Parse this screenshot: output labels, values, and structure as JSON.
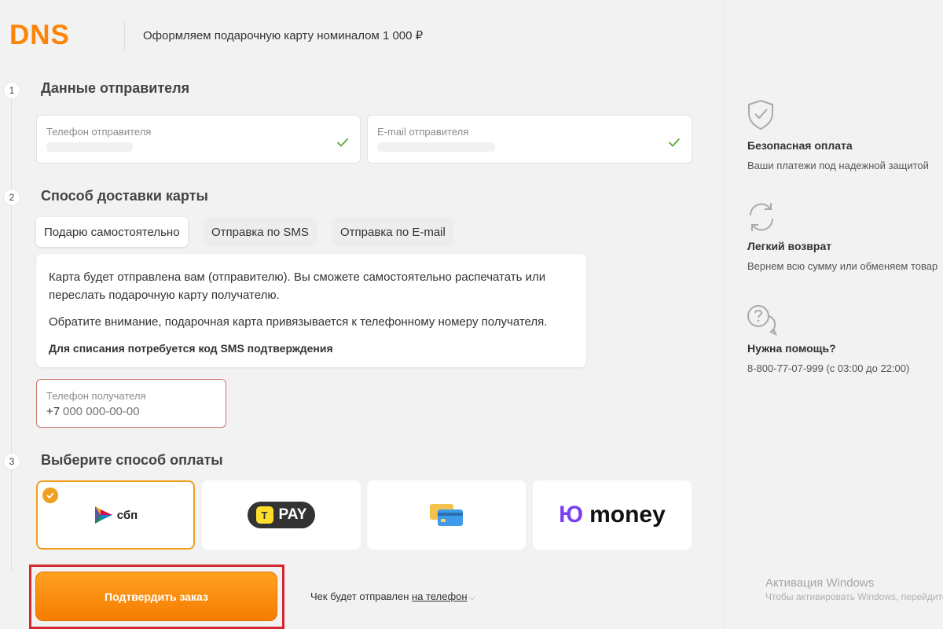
{
  "header": {
    "logo_text": "DNS",
    "title": "Оформляем подарочную карту номиналом 1 000 ₽"
  },
  "steps": [
    {
      "number": "1",
      "title": "Данные отправителя"
    },
    {
      "number": "2",
      "title": "Способ доставки карты"
    },
    {
      "number": "3",
      "title": "Выберите способ оплаты"
    }
  ],
  "sender": {
    "phone_label": "Телефон отправителя",
    "email_label": "E-mail отправителя"
  },
  "delivery_tabs": [
    {
      "label": "Подарю самостоятельно",
      "active": true
    },
    {
      "label": "Отправка по SMS",
      "active": false
    },
    {
      "label": "Отправка по E-mail",
      "active": false
    }
  ],
  "info": {
    "line1": "Карта будет отправлена вам (отправителю). Вы сможете самостоятельно распечатать или переслать подарочную карту получателю.",
    "line2": "Обратите внимание, подарочная карта привязывается к телефонному номеру получателя.",
    "line3": "Для списания потребуется код SMS подтверждения"
  },
  "recipient": {
    "label": "Телефон получателя",
    "prefix": "+7",
    "placeholder": "000 000-00-00"
  },
  "payments": [
    {
      "name": "СБП",
      "text": "сбп",
      "selected": true
    },
    {
      "name": "T-Pay",
      "text": "PAY",
      "badge": "T",
      "selected": false
    },
    {
      "name": "Card",
      "text": "",
      "selected": false
    },
    {
      "name": "ЮMoney",
      "mark": "Ю",
      "text": "money",
      "selected": false
    }
  ],
  "confirm": {
    "label": "Подтвердить заказ",
    "receipt_prefix": "Чек будет отправлен",
    "receipt_link": "на телефон"
  },
  "features": [
    {
      "icon": "shield-check-icon",
      "title": "Безопасная оплата",
      "desc": "Ваши платежи под надежной защитой"
    },
    {
      "icon": "refresh-icon",
      "title": "Легкий возврат",
      "desc": "Вернем всю сумму или обменяем товар"
    },
    {
      "icon": "help-chat-icon",
      "title": "Нужна помощь?",
      "desc": "8-800-77-07-999 (с 03:00 до 22:00)"
    }
  ],
  "watermark": {
    "title": "Активация Windows",
    "subtitle": "Чтобы активировать Windows, перейдите"
  },
  "colors": {
    "accent": "#f57c00",
    "logo": "#fc8507",
    "check": "#5aa832",
    "error_border": "#c9796a",
    "highlight_frame": "#d4282f"
  }
}
